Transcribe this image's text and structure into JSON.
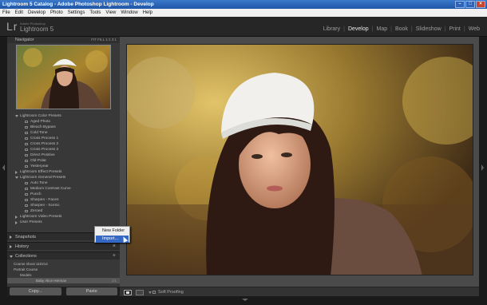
{
  "window": {
    "title": "Lightroom 5 Catalog - Adobe Photoshop Lightroom - Develop",
    "controls": [
      "–",
      "□",
      "×"
    ]
  },
  "menu": [
    "File",
    "Edit",
    "Develop",
    "Photo",
    "Settings",
    "Tools",
    "View",
    "Window",
    "Help"
  ],
  "identity": {
    "logo": "Lr",
    "line1": "Adobe Photoshop",
    "line2": "Lightroom 5"
  },
  "modules": [
    {
      "label": "Library",
      "active": false
    },
    {
      "label": "Develop",
      "active": true
    },
    {
      "label": "Map",
      "active": false
    },
    {
      "label": "Book",
      "active": false
    },
    {
      "label": "Slideshow",
      "active": false
    },
    {
      "label": "Print",
      "active": false
    },
    {
      "label": "Web",
      "active": false
    }
  ],
  "navigator": {
    "title": "Navigator",
    "zoom": "FIT  FILL  1:1  3:1"
  },
  "presets": [
    {
      "label": "Lightroom Color Presets",
      "type": "folder",
      "open": true
    },
    {
      "label": "Aged Photo",
      "type": "item"
    },
    {
      "label": "Bleach Bypass",
      "type": "item"
    },
    {
      "label": "Cold Tone",
      "type": "item"
    },
    {
      "label": "Cross Process 1",
      "type": "item"
    },
    {
      "label": "Cross Process 2",
      "type": "item"
    },
    {
      "label": "Cross Process 3",
      "type": "item"
    },
    {
      "label": "Direct Positive",
      "type": "item"
    },
    {
      "label": "Old Polar",
      "type": "item"
    },
    {
      "label": "Yesteryear",
      "type": "item"
    },
    {
      "label": "Lightroom Effect Presets",
      "type": "folder",
      "open": false
    },
    {
      "label": "Lightroom General Presets",
      "type": "folder",
      "open": true
    },
    {
      "label": "Auto Tone",
      "type": "item"
    },
    {
      "label": "Medium Contrast Curve",
      "type": "item"
    },
    {
      "label": "Punch",
      "type": "item"
    },
    {
      "label": "Sharpen - Faces",
      "type": "item"
    },
    {
      "label": "Sharpen - Scenic",
      "type": "item"
    },
    {
      "label": "Zeroed",
      "type": "item"
    },
    {
      "label": "Lightroom Video Presets",
      "type": "folder",
      "open": false
    },
    {
      "label": "User Presets",
      "type": "folder",
      "open": false
    }
  ],
  "panels": {
    "snapshots": "Snapshots",
    "history": "History",
    "collections": "Collections"
  },
  "collections": [
    {
      "label": "Course shoot 110214",
      "indent": 1,
      "count": ""
    },
    {
      "label": "Portrait Course",
      "indent": 1,
      "count": ""
    },
    {
      "label": "Models",
      "indent": 2,
      "count": ""
    },
    {
      "label": "Baby Alice Herman",
      "indent": 3,
      "count": "1/1"
    }
  ],
  "context_menu": {
    "new_folder": "New Folder",
    "import": "Import..."
  },
  "buttons": {
    "copy": "Copy...",
    "paste": "Paste"
  },
  "toolbar": {
    "soft_proofing": "Soft Proofing"
  }
}
